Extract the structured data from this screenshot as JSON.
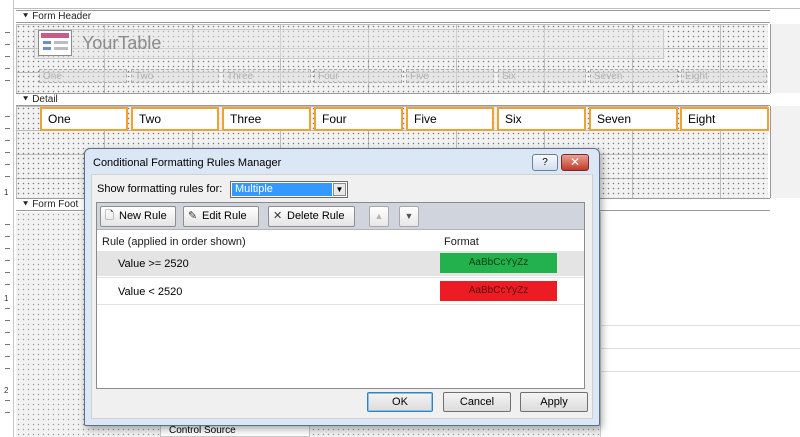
{
  "sections": {
    "form_header": "Form Header",
    "detail": "Detail",
    "form_footer": "Form Foot"
  },
  "header": {
    "title": "YourTable",
    "column_labels": [
      "One",
      "Two",
      "Three",
      "Four",
      "Five",
      "Six",
      "Seven",
      "Eight"
    ]
  },
  "detail": {
    "fields": [
      "One",
      "Two",
      "Three",
      "Four",
      "Five",
      "Six",
      "Seven",
      "Eight"
    ]
  },
  "ruler": {
    "numbers": [
      "1",
      "1",
      "2"
    ]
  },
  "property_sheet": {
    "control_source_label": "Control Source"
  },
  "dialog": {
    "title": "Conditional Formatting Rules Manager",
    "help_label": "?",
    "close_label": "✕",
    "show_rules_label": "Show formatting rules for:",
    "show_rules_value": "Multiple",
    "toolbar": {
      "new_rule": "New Rule",
      "edit_rule": "Edit Rule",
      "delete_rule": "Delete Rule"
    },
    "columns": {
      "rule": "Rule (applied in order shown)",
      "format": "Format"
    },
    "rules": [
      {
        "rule": "Value >= 2520",
        "format_sample": "AaBbCcYyZz",
        "color": "#22b14c"
      },
      {
        "rule": "Value < 2520",
        "format_sample": "AaBbCcYyZz",
        "color": "#ed1c24"
      }
    ],
    "buttons": {
      "ok": "OK",
      "cancel": "Cancel",
      "apply": "Apply"
    }
  },
  "colors": {
    "field_border": "#f0a133",
    "selection_blue": "#3399ff",
    "dialog_bg": "#dbe7f4"
  }
}
